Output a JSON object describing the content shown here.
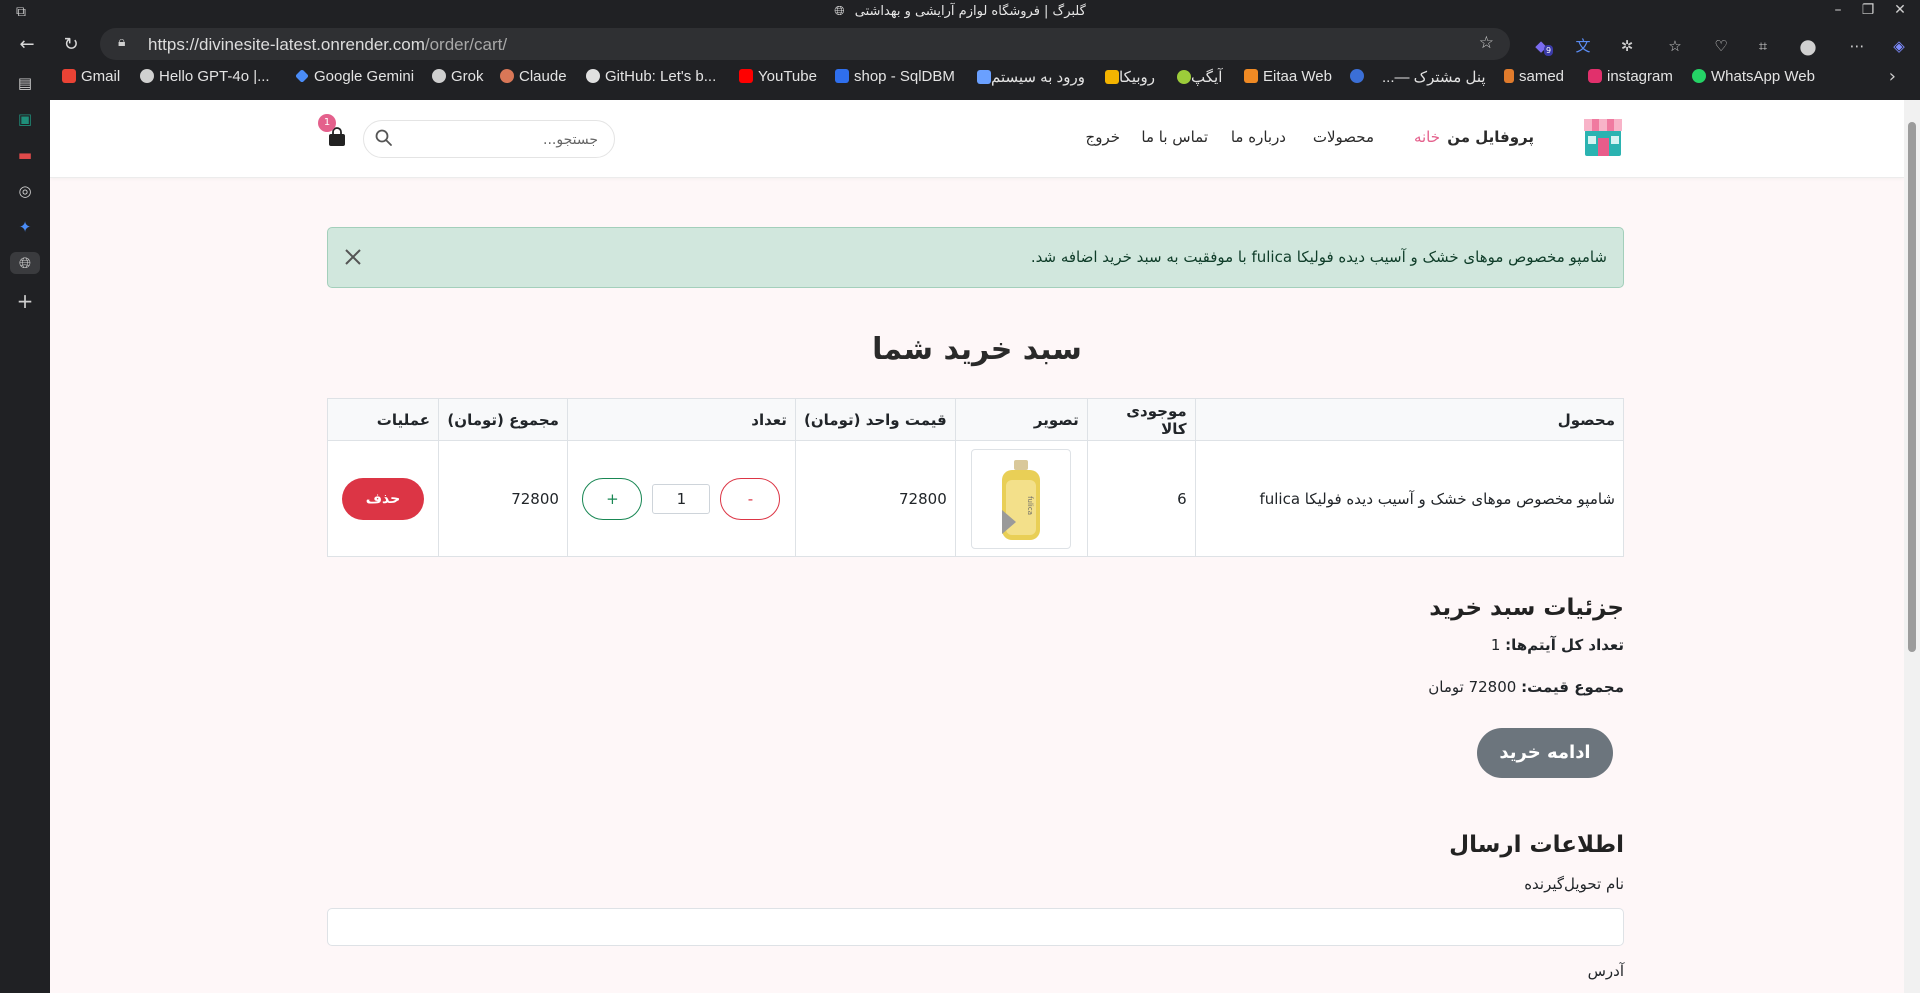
{
  "window": {
    "title": "گلبرگ | فروشگاه لوازم آرایشی و بهداشتی"
  },
  "browser": {
    "url_domain": "https://divinesite-latest.onrender.com",
    "url_path": "/order/cart/",
    "extension_badge": "9",
    "bookmarks": [
      {
        "label": "Gmail",
        "color": "#ea4335"
      },
      {
        "label": "Hello GPT-4o |...",
        "color": "#d0d0d0"
      },
      {
        "label": "Google Gemini",
        "color": "#4a8cf7"
      },
      {
        "label": "Grok",
        "color": "#d0d0d0"
      },
      {
        "label": "Claude",
        "color": "#d97757"
      },
      {
        "label": "GitHub: Let's b...",
        "color": "#d0d0d0"
      },
      {
        "label": "YouTube",
        "color": "#ff0000"
      },
      {
        "label": "shop - SqlDBM",
        "color": "#2f6fed"
      },
      {
        "label": "ورود به سیستم",
        "color": "#6aa0ff"
      },
      {
        "label": "روبیکا",
        "color": "#f4b400"
      },
      {
        "label": "آیگپ",
        "color": "#9ccc3a"
      },
      {
        "label": "Eitaa Web",
        "color": "#f08a24"
      },
      {
        "label": "",
        "color": "#3b6fd6"
      },
      {
        "label": "پنل مشترک —...",
        "color": "#d0d0d0"
      },
      {
        "label": "samed",
        "color": "#e07b2c"
      },
      {
        "label": "instagram",
        "color": "#e1306c"
      },
      {
        "label": "WhatsApp Web",
        "color": "#25d366"
      }
    ]
  },
  "header": {
    "menu": {
      "profile": "پروفایل من",
      "home": "خانه",
      "products": "محصولات",
      "about": "درباره ما",
      "contact": "تماس با ما",
      "logout": "خروج"
    },
    "search_placeholder": "جستجو...",
    "cart_count": "1",
    "accent": "#e4608c"
  },
  "alert": {
    "message": "شامپو مخصوص موهای خشک و آسیب دیده فولیکا fulica با موفقیت به سبد خرید اضافه شد."
  },
  "cart": {
    "title": "سبد خرید شما",
    "columns": [
      "محصول",
      "موجودی کالا",
      "تصویر",
      "قیمت واحد (تومان)",
      "تعداد",
      "مجموع (تومان)",
      "عملیات"
    ],
    "rows": [
      {
        "product": "شامپو مخصوص موهای خشک و آسیب دیده فولیکا fulica",
        "stock": "6",
        "unit_price": "72800",
        "quantity": "1",
        "total": "72800",
        "minus_label": "-",
        "plus_label": "+",
        "delete_label": "حذف"
      }
    ]
  },
  "details": {
    "title": "جزئیات سبد خرید",
    "items_label": "تعداد کل آیتم‌ها:",
    "items_value": "1",
    "price_label": "مجموع قیمت:",
    "price_value": "72800 تومان",
    "checkout_label": "ادامه خرید"
  },
  "shipping": {
    "title": "اطلاعات ارسال",
    "recipient_label": "نام تحویل‌گیرنده",
    "address_label": "آدرس"
  }
}
